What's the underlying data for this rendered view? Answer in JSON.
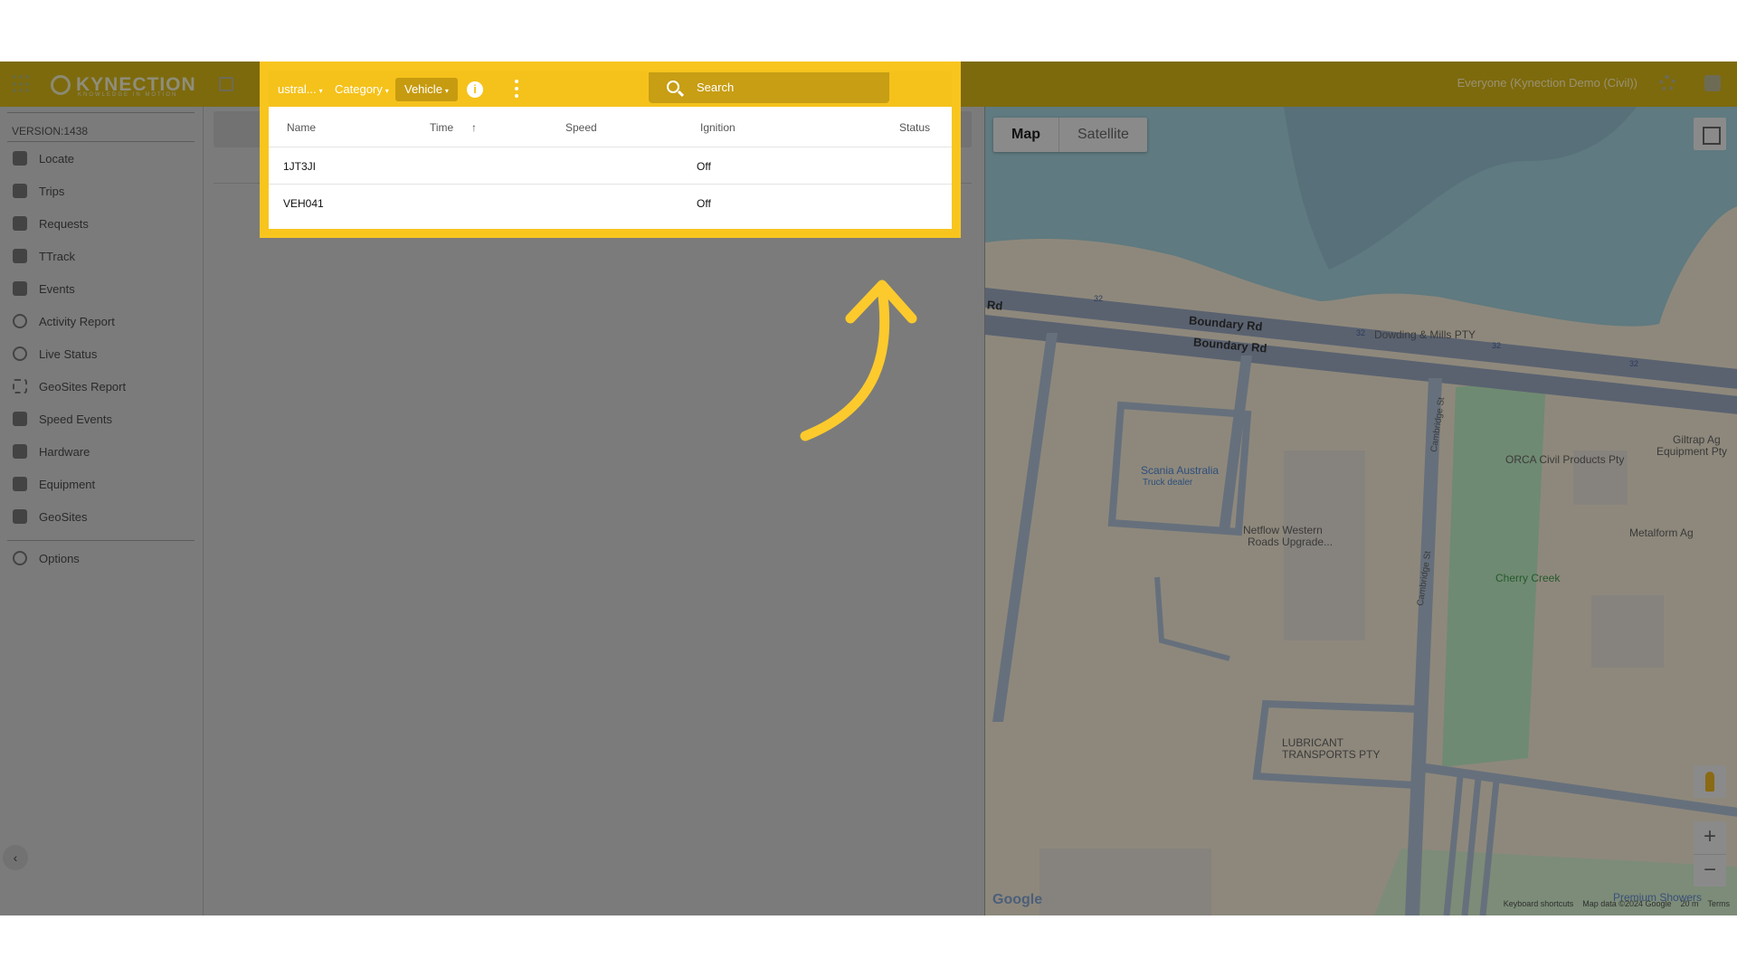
{
  "topbar": {
    "logo_text": "KYNECTION",
    "logo_tagline": "KNOWLEDGE IN MOTION",
    "account_selector": "Everyone (Kynection Demo (Civil))"
  },
  "sidebar": {
    "version": "VERSION:1438",
    "items": [
      {
        "label": "Locate",
        "icon": "map-icon"
      },
      {
        "label": "Trips",
        "icon": "trips-icon"
      },
      {
        "label": "Requests",
        "icon": "requests-icon"
      },
      {
        "label": "TTrack",
        "icon": "ttrack-icon"
      },
      {
        "label": "Events",
        "icon": "events-icon"
      },
      {
        "label": "Activity Report",
        "icon": "person-pin-icon"
      },
      {
        "label": "Live Status",
        "icon": "check-circle-icon"
      },
      {
        "label": "GeoSites Report",
        "icon": "dashed-square-icon"
      },
      {
        "label": "Speed Events",
        "icon": "road-icon"
      },
      {
        "label": "Hardware",
        "icon": "wrench-icon"
      },
      {
        "label": "Equipment",
        "icon": "excavator-icon"
      },
      {
        "label": "GeoSites",
        "icon": "star-icon"
      }
    ],
    "options_label": "Options"
  },
  "panel": {
    "filters": [
      {
        "label": "ustral...",
        "active": false
      },
      {
        "label": "Category",
        "active": false
      },
      {
        "label": "Vehicle",
        "active": true
      }
    ],
    "search_label": "Search",
    "columns": {
      "name": "Name",
      "time": "Time",
      "sort_indicator": "↑",
      "speed": "Speed",
      "ignition": "Ignition",
      "status": "Status"
    },
    "rows": [
      {
        "name": "1JT3JI",
        "time": "",
        "speed": "",
        "ignition": "Off",
        "status": ""
      },
      {
        "name": "VEH041",
        "time": "",
        "speed": "",
        "ignition": "Off",
        "status": ""
      }
    ]
  },
  "map": {
    "tabs": {
      "map": "Map",
      "satellite": "Satellite"
    },
    "labels": {
      "road_left": "Rd",
      "boundary_1": "Boundary Rd",
      "boundary_2": "Boundary Rd",
      "dowding": "Dowding & Mills PTY",
      "scania": "Scania Australia",
      "scania_sub": "Truck dealer",
      "netflow_1": "Netflow Western",
      "netflow_2": "Roads Upgrade...",
      "orca": "ORCA Civil Products Pty",
      "giltrap_1": "Giltrap Ag",
      "giltrap_2": "Equipment Pty",
      "metalform": "Metalform Ag",
      "cherry": "Cherry Creek",
      "lubricant_1": "LUBRICANT",
      "lubricant_2": "TRANSPORTS PTY",
      "cambridge_1": "Cambridge St",
      "cambridge_2": "Cambridge St",
      "premium": "Premium Showers"
    },
    "route_shields": [
      "32",
      "32",
      "32",
      "32"
    ],
    "google": "Google",
    "footer": {
      "shortcuts": "Keyboard shortcuts",
      "data": "Map data ©2024 Google",
      "scale": "20 m",
      "terms": "Terms"
    },
    "zoom_in": "+",
    "zoom_out": "−"
  },
  "colors": {
    "highlight": "#f8c51f",
    "topbar": "#7d6a0d",
    "overlay_gray": "#7b7b7b"
  }
}
